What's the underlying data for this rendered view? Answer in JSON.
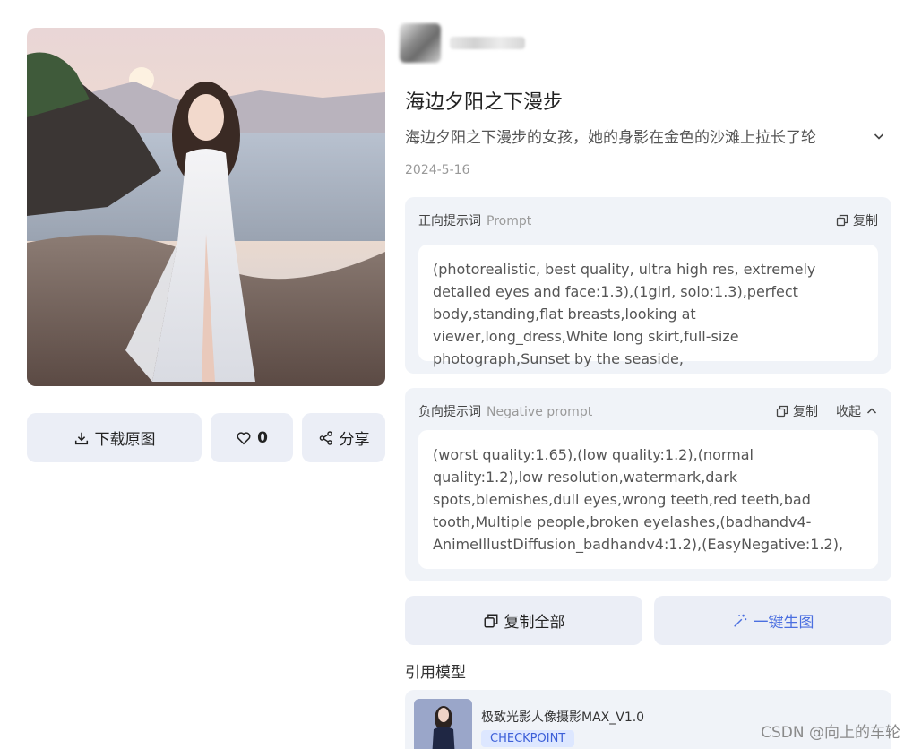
{
  "actions": {
    "download_label": "下载原图",
    "like_count": "0",
    "share_label": "分享"
  },
  "post": {
    "title": "海边夕阳之下漫步",
    "description": "海边夕阳之下漫步的女孩，她的身影在金色的沙滩上拉长了轮",
    "date": "2024-5-16"
  },
  "prompt": {
    "label": "正向提示词",
    "sublabel": "Prompt",
    "copy_label": "复制",
    "text": "(photorealistic, best quality, ultra high res, extremely detailed eyes and face:1.3),(1girl, solo:1.3),perfect body,standing,flat breasts,looking at viewer,long_dress,White long skirt,full-size photograph,Sunset by the seaside,"
  },
  "negative_prompt": {
    "label": "负向提示词",
    "sublabel": "Negative prompt",
    "copy_label": "复制",
    "collapse_label": "收起",
    "text": "(worst quality:1.65),(low quality:1.2),(normal quality:1.2),low resolution,watermark,dark spots,blemishes,dull eyes,wrong teeth,red teeth,bad tooth,Multiple people,broken eyelashes,(badhandv4-AnimeIllustDiffusion_badhandv4:1.2),(EasyNegative:1.2),"
  },
  "bottom_actions": {
    "copy_all_label": "复制全部",
    "generate_label": "一键生图"
  },
  "models": {
    "section_title": "引用模型",
    "items": [
      {
        "name": "极致光影人像摄影MAX_V1.0",
        "badge": "CHECKPOINT"
      }
    ]
  },
  "watermark": "CSDN @向上的车轮",
  "colors": {
    "button_bg": "#ebeef6",
    "panel_bg": "#f0f3f8",
    "accent_blue": "#4b6fe0",
    "badge_bg": "#dde7ff"
  }
}
